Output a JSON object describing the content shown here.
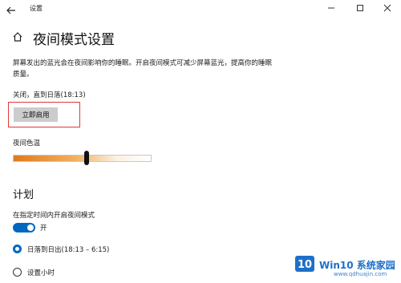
{
  "window": {
    "title": "设置",
    "back_icon": "arrow-left-icon",
    "controls": [
      "—",
      "☐",
      "✕"
    ]
  },
  "page": {
    "home_icon": "home-icon",
    "title": "夜间模式设置",
    "description": "屏幕发出的蓝光会在夜间影响你的睡眠。开启夜间模式可减少屏幕蓝光，提高你的睡眠质量。",
    "status": "关闭，直到日落(18:13)",
    "enable_button": "立即启用",
    "highlight_color": "#e0383a"
  },
  "color_temperature": {
    "label": "夜间色温",
    "value": 0.53
  },
  "schedule": {
    "heading": "计划",
    "toggle_label": "在指定时间内开启夜间模式",
    "toggle_state": "开",
    "toggle_on": true,
    "options": [
      {
        "label": "日落到日出(18:13 – 6:15)",
        "selected": true
      },
      {
        "label": "设置小时",
        "selected": false
      }
    ]
  },
  "watermark": {
    "text": "Win10 系统家园",
    "url": "www.qdhuajin.com"
  },
  "colors": {
    "accent": "#0067c0",
    "button_bg": "#cccccc"
  }
}
